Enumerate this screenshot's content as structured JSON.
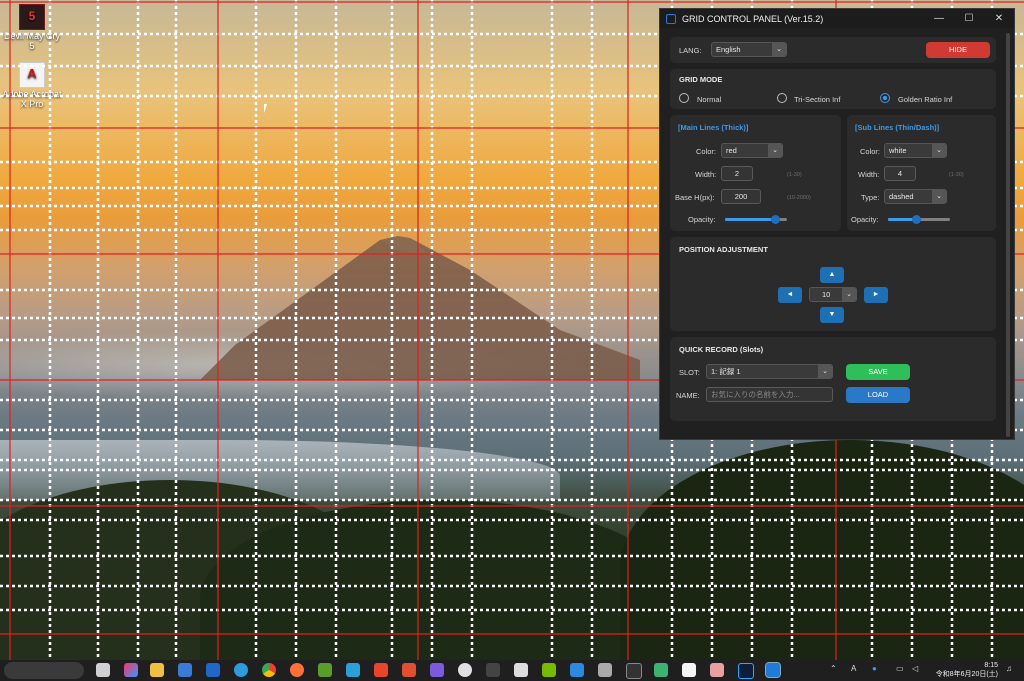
{
  "desktop": {
    "icons": [
      {
        "label": "Devil May Cry 5"
      },
      {
        "label": "Adobe Acrobat X Pro"
      }
    ]
  },
  "window": {
    "title": "GRID CONTROL PANEL (Ver.15.2)",
    "controls": {
      "minimize": "—",
      "maximize": "☐",
      "close": "✕"
    }
  },
  "lang": {
    "label": "LANG:",
    "value": "English",
    "hide_label": "HIDE"
  },
  "grid_mode": {
    "title": "GRID MODE",
    "options": [
      "Normal",
      "Tri-Section Inf",
      "Golden Ratio Inf"
    ],
    "selected": "Golden Ratio Inf"
  },
  "main_lines": {
    "title": "[Main Lines (Thick)]",
    "color_label": "Color:",
    "color_value": "red",
    "width_label": "Width:",
    "width_value": "2",
    "width_hint": "(1-30)",
    "base_label": "Base H(px):",
    "base_value": "200",
    "base_hint": "(10-2000)",
    "opacity_label": "Opacity:",
    "opacity": 0.8
  },
  "sub_lines": {
    "title": "[Sub Lines (Thin/Dash)]",
    "color_label": "Color:",
    "color_value": "white",
    "width_label": "Width:",
    "width_value": "4",
    "width_hint": "(1-30)",
    "type_label": "Type:",
    "type_value": "dashed",
    "opacity_label": "Opacity:",
    "opacity": 0.45
  },
  "position": {
    "title": "POSITION ADJUSTMENT",
    "step_value": "10",
    "up": "▲",
    "down": "▼",
    "left": "◄",
    "right": "►"
  },
  "quick_record": {
    "title": "QUICK RECORD (Slots)",
    "slot_label": "SLOT:",
    "slot_value": "1: 記録 1",
    "save_label": "SAVE",
    "name_label": "NAME:",
    "name_placeholder": "お気に入りの名前を入力...",
    "load_label": "LOAD"
  },
  "taskbar": {
    "tray_letter": "A",
    "time": "8:15",
    "date": "令和8年6月20日(土)"
  },
  "colors": {
    "accent": "#3d9ae8",
    "hide_button": "#d03a32",
    "save_button": "#2fbf5a",
    "load_button": "#2a78c8",
    "main_grid_line": "#e02020",
    "sub_grid_line": "#ffffff"
  }
}
